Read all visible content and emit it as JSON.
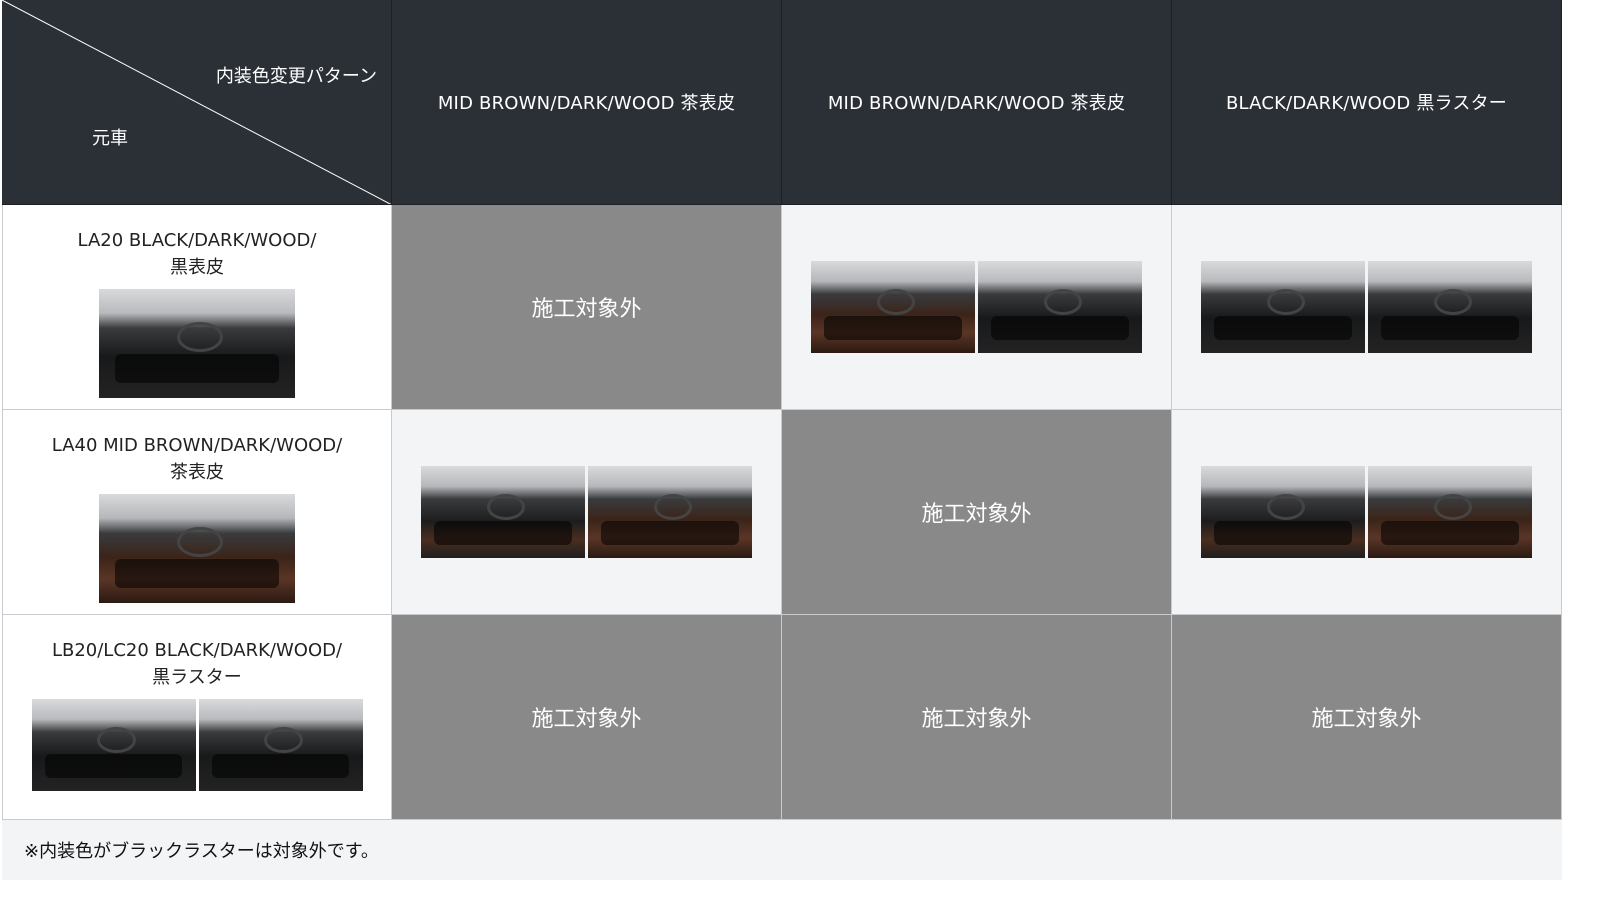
{
  "header": {
    "corner_pattern_label": "内装色変更パターン",
    "corner_origin_label": "元車",
    "columns": [
      "MID BROWN/DARK/WOOD 茶表皮",
      "MID BROWN/DARK/WOOD 茶表皮",
      "BLACK/DARK/WOOD 黒ラスター"
    ]
  },
  "rows": [
    {
      "label_line1": "LA20 BLACK/DARK/WOOD/",
      "label_line2": "黒表皮",
      "cells": [
        "施工対象外",
        "",
        ""
      ]
    },
    {
      "label_line1": "LA40 MID BROWN/DARK/WOOD/",
      "label_line2": "茶表皮",
      "cells": [
        "",
        "施工対象外",
        ""
      ]
    },
    {
      "label_line1": "LB20/LC20 BLACK/DARK/WOOD/",
      "label_line2": "黒ラスター",
      "cells": [
        "施工対象外",
        "施工対象外",
        "施工対象外"
      ]
    }
  ],
  "footer_note": "※内装色がブラックラスターは対象外です。",
  "colors": {
    "header_bg": "#2b3037",
    "not_applicable_bg": "#898989",
    "applicable_bg": "#f3f4f6"
  }
}
